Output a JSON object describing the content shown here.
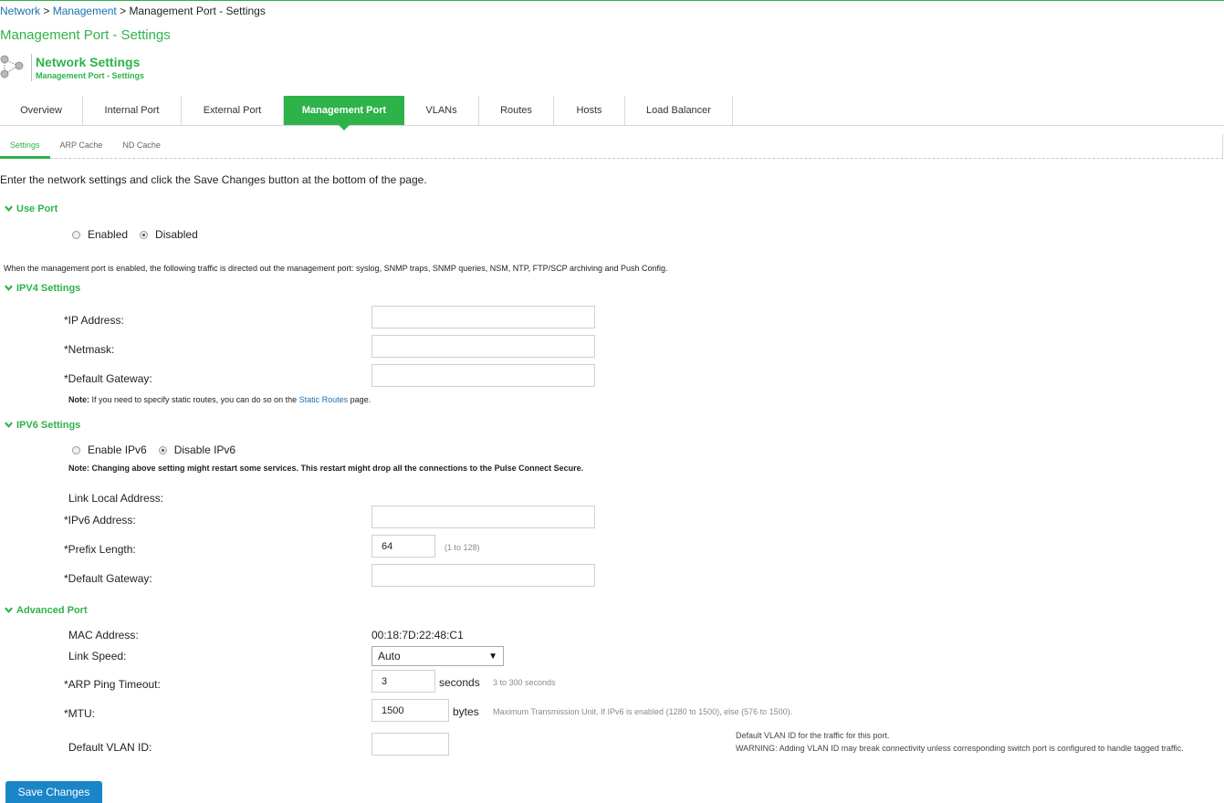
{
  "breadcrumb": {
    "items": [
      "Network",
      "Management"
    ],
    "separator": ">",
    "current": "Management Port - Settings"
  },
  "page_title": "Management Port - Settings",
  "header": {
    "icon": "network-nodes-icon",
    "title": "Network Settings",
    "subtitle": "Management Port - Settings"
  },
  "tabs": [
    {
      "label": "Overview",
      "active": false
    },
    {
      "label": "Internal Port",
      "active": false
    },
    {
      "label": "External Port",
      "active": false
    },
    {
      "label": "Management Port",
      "active": true
    },
    {
      "label": "VLANs",
      "active": false
    },
    {
      "label": "Routes",
      "active": false
    },
    {
      "label": "Hosts",
      "active": false
    },
    {
      "label": "Load Balancer",
      "active": false
    }
  ],
  "subtabs": [
    {
      "label": "Settings",
      "active": true
    },
    {
      "label": "ARP Cache",
      "active": false
    },
    {
      "label": "ND Cache",
      "active": false
    }
  ],
  "intro": "Enter the network settings and click the Save Changes button at the bottom of the page.",
  "use_port": {
    "title": "Use Port",
    "options": [
      {
        "label": "Enabled",
        "checked": false
      },
      {
        "label": "Disabled",
        "checked": true
      }
    ],
    "info": "When the management port is enabled, the following traffic is directed out the management port: syslog, SNMP traps, SNMP queries, NSM, NTP, FTP/SCP archiving and Push Config."
  },
  "ipv4": {
    "title": "IPV4 Settings",
    "ip_label": "*IP Address:",
    "ip_value": "",
    "netmask_label": "*Netmask:",
    "netmask_value": "",
    "gateway_label": "*Default Gateway:",
    "gateway_value": "",
    "note_prefix": "Note:",
    "note_text": " If you need to specify static routes, you can do so on the ",
    "note_link": "Static Routes",
    "note_suffix": " page."
  },
  "ipv6": {
    "title": "IPV6 Settings",
    "options": [
      {
        "label": "Enable IPv6",
        "checked": false
      },
      {
        "label": "Disable IPv6",
        "checked": true
      }
    ],
    "note": "Note: Changing above setting might restart some services. This restart might drop all the connections to the Pulse Connect Secure.",
    "link_local_label": "Link Local Address:",
    "address_label": "*IPv6 Address:",
    "address_value": "",
    "prefix_label": "*Prefix Length:",
    "prefix_value": "64",
    "prefix_hint": "(1 to 128)",
    "gateway_label": "*Default Gateway:",
    "gateway_value": ""
  },
  "advanced": {
    "title": "Advanced Port",
    "mac_label": "MAC Address:",
    "mac_value": "00:18:7D:22:48:C1",
    "link_speed_label": "Link Speed:",
    "link_speed_value": "Auto",
    "arp_label": "*ARP Ping Timeout:",
    "arp_value": "3",
    "arp_unit": "seconds",
    "arp_hint": "3 to 300 seconds",
    "mtu_label": "*MTU:",
    "mtu_value": "1500",
    "mtu_unit": "bytes",
    "mtu_hint": "Maximum Transmission Unit. If IPv6 is enabled (1280 to 1500), else (576 to 1500).",
    "vlan_label": "Default VLAN ID:",
    "vlan_value": "",
    "vlan_help_1": "Default VLAN ID for the traffic for this port.",
    "vlan_help_2": "WARNING: Adding VLAN ID may break connectivity unless corresponding switch port is configured to handle tagged traffic."
  },
  "save_button": "Save Changes",
  "colors": {
    "accent": "#2db34a",
    "link": "#1a6fb3",
    "button": "#1a86c8"
  }
}
